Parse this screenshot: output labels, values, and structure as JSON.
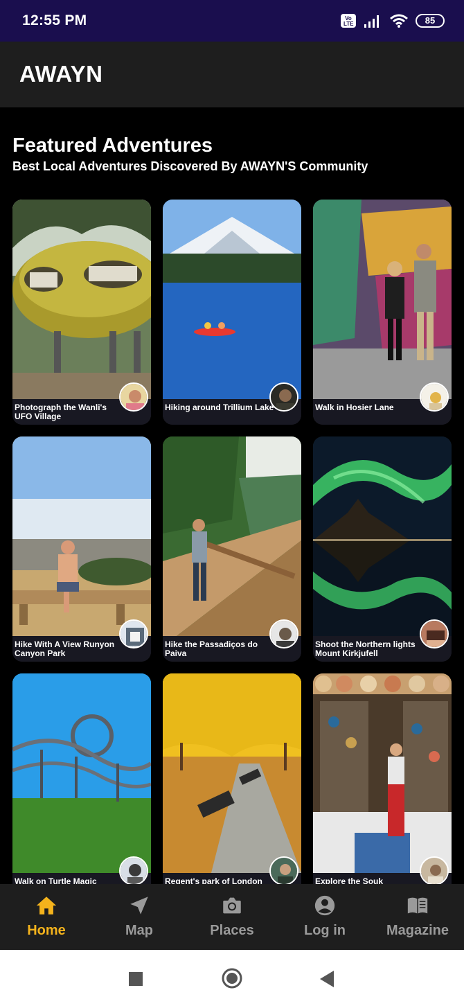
{
  "status_bar": {
    "time": "12:55 PM",
    "volte_label": "Vo LTE",
    "battery": "85",
    "icons": [
      "volte-icon",
      "signal-icon",
      "wifi-icon",
      "battery-icon"
    ]
  },
  "app": {
    "title": "AWAYN"
  },
  "section": {
    "title": "Featured Adventures",
    "subtitle": "Best Local Adventures Discovered By AWAYN'S Community"
  },
  "cards": [
    {
      "title": "Photograph the Wanli's UFO Village"
    },
    {
      "title": "Hiking around Trillium Lake"
    },
    {
      "title": "Walk in Hosier Lane"
    },
    {
      "title": "Hike With A View Runyon Canyon Park"
    },
    {
      "title": "Hike the Passadiços do Paiva"
    },
    {
      "title": "Shoot the Northern lights Mount Kirkjufell"
    },
    {
      "title": "Walk on Turtle Magic"
    },
    {
      "title": "Regent's park of London"
    },
    {
      "title": "Explore the Souk"
    }
  ],
  "bottom_nav": {
    "items": [
      {
        "label": "Home",
        "icon": "home-icon",
        "active": true
      },
      {
        "label": "Map",
        "icon": "navigation-arrow-icon",
        "active": false
      },
      {
        "label": "Places",
        "icon": "camera-icon",
        "active": false
      },
      {
        "label": "Log in",
        "icon": "account-circle-icon",
        "active": false
      },
      {
        "label": "Magazine",
        "icon": "book-open-icon",
        "active": false
      }
    ]
  },
  "system_nav": {
    "icons": [
      "recents-square-icon",
      "home-circle-icon",
      "back-triangle-icon"
    ]
  },
  "colors": {
    "status_bar_bg": "#1a0e4e",
    "app_bar_bg": "#1e1e1e",
    "page_bg": "#000000",
    "accent": "#f4b31c",
    "nav_inactive": "#9a9a9a"
  }
}
